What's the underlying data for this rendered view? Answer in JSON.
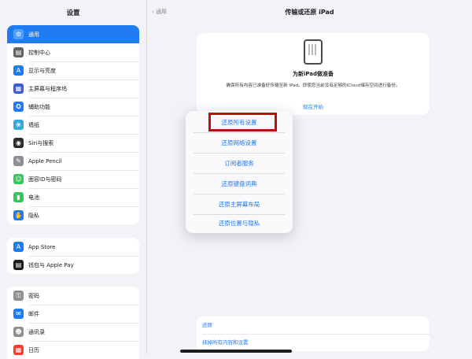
{
  "sidebar": {
    "title": "设置",
    "group1": [
      {
        "label": "通用",
        "icon": "gear-icon",
        "color": "#8e8e93",
        "glyph": "⚙",
        "selected": true
      },
      {
        "label": "控制中心",
        "icon": "control-center-icon",
        "color": "#636366",
        "glyph": "▤"
      },
      {
        "label": "显示与亮度",
        "icon": "brightness-icon",
        "color": "#1f7cf0",
        "glyph": "A"
      },
      {
        "label": "主屏幕与程序坞",
        "icon": "home-screen-icon",
        "color": "#3b5bdb",
        "glyph": "▦"
      },
      {
        "label": "辅助功能",
        "icon": "accessibility-icon",
        "color": "#1f7cf0",
        "glyph": "✪"
      },
      {
        "label": "墙纸",
        "icon": "wallpaper-icon",
        "color": "#34aadc",
        "glyph": "❀"
      },
      {
        "label": "Siri与搜索",
        "icon": "siri-icon",
        "color": "#2c2c2e",
        "glyph": "◉"
      },
      {
        "label": "Apple Pencil",
        "icon": "pencil-icon",
        "color": "#8e8e93",
        "glyph": "✎"
      },
      {
        "label": "面容ID与密码",
        "icon": "face-id-icon",
        "color": "#34c759",
        "glyph": "☺"
      },
      {
        "label": "电池",
        "icon": "battery-icon",
        "color": "#34c759",
        "glyph": "▮"
      },
      {
        "label": "隐私",
        "icon": "privacy-hand-icon",
        "color": "#1f7cf0",
        "glyph": "✋"
      }
    ],
    "group2": [
      {
        "label": "App Store",
        "icon": "app-store-icon",
        "color": "#1f7cf0",
        "glyph": "A"
      },
      {
        "label": "钱包与 Apple Pay",
        "icon": "wallet-icon",
        "color": "#1c1c1e",
        "glyph": "▤"
      }
    ],
    "group3": [
      {
        "label": "密码",
        "icon": "key-icon",
        "color": "#8e8e93",
        "glyph": "⚿"
      },
      {
        "label": "邮件",
        "icon": "mail-icon",
        "color": "#1f7cf0",
        "glyph": "✉"
      },
      {
        "label": "通讯录",
        "icon": "contacts-icon",
        "color": "#8e8e93",
        "glyph": "☻"
      },
      {
        "label": "日历",
        "icon": "calendar-icon",
        "color": "#ff3b30",
        "glyph": "▦"
      }
    ]
  },
  "main": {
    "back_label": "通用",
    "title": "传输或还原 iPad",
    "card": {
      "title": "为新iPad做准备",
      "description": "确保所有内容已准备好传输至新 iPad。即使您当前没有足够的iCloud储存空间进行备份。",
      "link": "现在开始"
    },
    "bottom": [
      "还原",
      "抹掉所有内容和设置"
    ]
  },
  "menu": {
    "items": [
      "还原所有设置",
      "还原网络设置",
      "订阅者服务",
      "还原键盘词典",
      "还原主屏幕布局",
      "还原位置与隐私"
    ]
  }
}
